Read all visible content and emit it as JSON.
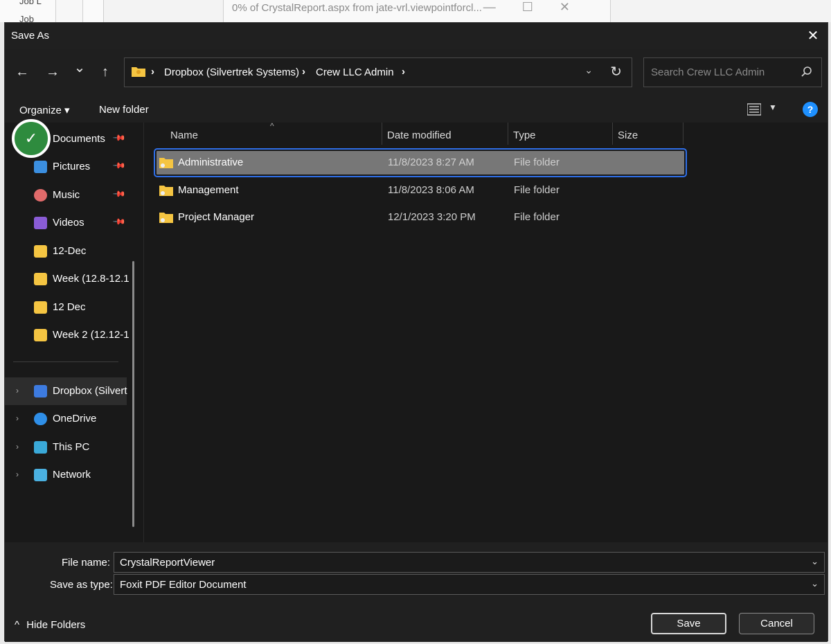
{
  "background_window": {
    "title": "0% of CrystalReport.aspx from jate-vrl.viewpointforcl...",
    "stub_1": "Job L",
    "stub_2": "Job"
  },
  "dialog": {
    "title": "Save As",
    "close_glyph": "✕"
  },
  "nav": {
    "back_glyph": "←",
    "forward_glyph": "→",
    "recent_glyph": "⌄",
    "up_glyph": "↑",
    "breadcrumbs": [
      "Dropbox (Silvertrek Systems)",
      "Crew LLC Admin"
    ],
    "crumb_sep": "›",
    "dropdown_glyph": "⌄",
    "refresh_glyph": "↻",
    "search_placeholder": "Search Crew LLC Admin"
  },
  "toolbar": {
    "organize_label": "Organize ▾",
    "new_folder_label": "New folder",
    "view_dropdown_glyph": "▼",
    "help_glyph": "?"
  },
  "sidebar": {
    "quick_access": [
      {
        "label": "Documents",
        "icon": "documents-icon",
        "pinned": true
      },
      {
        "label": "Pictures",
        "icon": "pictures-icon",
        "pinned": true
      },
      {
        "label": "Music",
        "icon": "music-icon",
        "pinned": true
      },
      {
        "label": "Videos",
        "icon": "videos-icon",
        "pinned": true
      },
      {
        "label": "12-Dec",
        "icon": "folder-icon",
        "pinned": false
      },
      {
        "label": "Week (12.8-12.1-",
        "icon": "folder-icon",
        "pinned": false
      },
      {
        "label": "12 Dec",
        "icon": "folder-icon",
        "pinned": false
      },
      {
        "label": "Week 2 (12.12-1.",
        "icon": "folder-icon",
        "pinned": false
      }
    ],
    "locations": [
      {
        "label": "Dropbox (Silvert",
        "icon": "dropbox-icon"
      },
      {
        "label": "OneDrive",
        "icon": "onedrive-icon"
      },
      {
        "label": "This PC",
        "icon": "this-pc-icon"
      },
      {
        "label": "Network",
        "icon": "network-icon"
      }
    ],
    "pin_glyph": "📌",
    "expander_glyph": "›",
    "check_glyph": "✓"
  },
  "filelist": {
    "columns": [
      "Name",
      "Date modified",
      "Type",
      "Size"
    ],
    "sort_glyph": "^",
    "rows": [
      {
        "name": "Administrative",
        "date": "11/8/2023 8:27 AM",
        "type": "File folder",
        "size": ""
      },
      {
        "name": "Management",
        "date": "11/8/2023 8:06 AM",
        "type": "File folder",
        "size": ""
      },
      {
        "name": "Project Manager",
        "date": "12/1/2023 3:20 PM",
        "type": "File folder",
        "size": ""
      }
    ]
  },
  "bottom": {
    "file_name_label": "File name:",
    "file_name_value": "CrystalReportViewer",
    "save_type_label": "Save as type:",
    "save_type_value": "Foxit PDF Editor Document",
    "dropdown_glyph": "⌄",
    "hide_folders_label": "Hide Folders",
    "hide_folders_glyph": "^",
    "save_label": "Save",
    "cancel_label": "Cancel"
  },
  "colors": {
    "accent_blue": "#2f6fe8",
    "check_green": "#2e8b3e",
    "folder_yellow": "#f5c542"
  }
}
